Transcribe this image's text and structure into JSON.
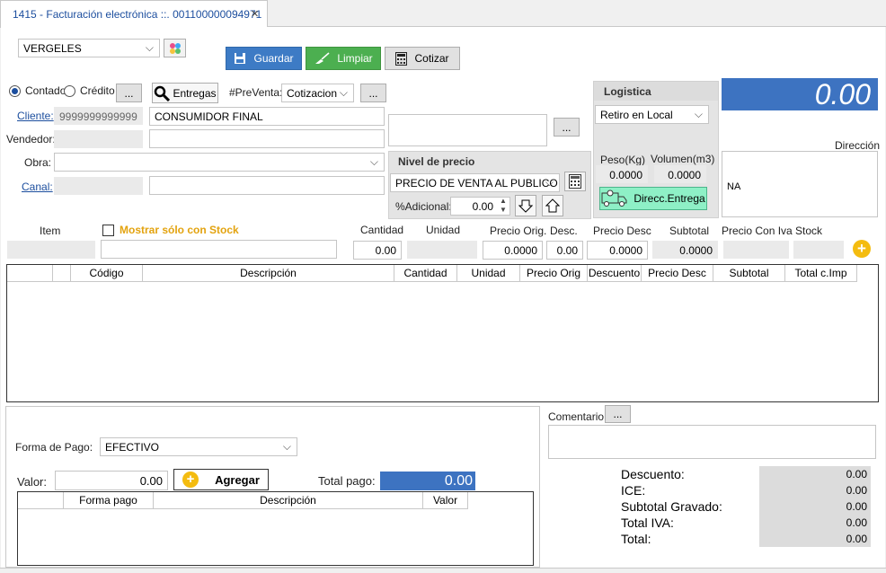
{
  "tab": {
    "title": "1415 - Facturación electrónica ::. 001100000094971",
    "close": "✕"
  },
  "top": {
    "location": "VERGELES",
    "save": "Guardar",
    "clear": "Limpiar",
    "quote": "Cotizar"
  },
  "payment_type": {
    "cash": "Contado",
    "credit": "Crédito",
    "more": "...",
    "deliveries": "Entregas",
    "presale_label": "#PreVenta:",
    "presale_value": "Cotizacion",
    "presale_more": "..."
  },
  "customer": {
    "client_label": "Cliente:",
    "client_id": "9999999999999",
    "client_name": "CONSUMIDOR FINAL",
    "seller_label": "Vendedor:",
    "work_label": "Obra:",
    "channel_label": "Canal:",
    "notes_more": "..."
  },
  "price_level": {
    "title": "Nivel de precio",
    "value": "PRECIO DE VENTA AL PUBLICO",
    "additional_label": "%Adicional:",
    "additional_value": "0.00"
  },
  "logistics": {
    "title": "Logistica",
    "mode": "Retiro en Local",
    "weight_label": "Peso(Kg)",
    "volume_label": "Volumen(m3)",
    "weight": "0.0000",
    "volume": "0.0000",
    "delivery_button": "Direcc.Entrega"
  },
  "total": "0.00",
  "address": {
    "label": "Dirección",
    "value": "NA"
  },
  "item_entry": {
    "item_label": "Item",
    "stock_only": "Mostrar sólo con Stock",
    "qty_label": "Cantidad",
    "unit_label": "Unidad",
    "orig_price_label": "Precio Orig.",
    "disc_label": "Desc.",
    "disc_price_label": "Precio Desc",
    "subtotal_label": "Subtotal",
    "price_iva_label": "Precio Con Iva",
    "stock_label": "Stock",
    "qty": "0.00",
    "orig_price": "0.0000",
    "disc": "0.00",
    "disc_price": "0.0000",
    "subtotal": "0.0000"
  },
  "items_grid": {
    "columns": [
      "Código",
      "Descripción",
      "Cantidad",
      "Unidad",
      "Precio Orig",
      "Descuento",
      "Precio Desc",
      "Subtotal",
      "Total c.Imp"
    ]
  },
  "payment": {
    "form_label": "Forma de Pago:",
    "form_value": "EFECTIVO",
    "value_label": "Valor:",
    "value": "0.00",
    "add": "Agregar",
    "total_label": "Total pago:",
    "total": "0.00",
    "columns": [
      "Forma pago",
      "Descripción",
      "Valor"
    ]
  },
  "comment": {
    "label": "Comentario:",
    "more": "..."
  },
  "summary": [
    {
      "label": "Descuento:",
      "value": "0.00"
    },
    {
      "label": "ICE:",
      "value": "0.00"
    },
    {
      "label": "Subtotal Gravado:",
      "value": "0.00"
    },
    {
      "label": "Total IVA:",
      "value": "0.00"
    },
    {
      "label": "Total:",
      "value": "0.00"
    }
  ]
}
